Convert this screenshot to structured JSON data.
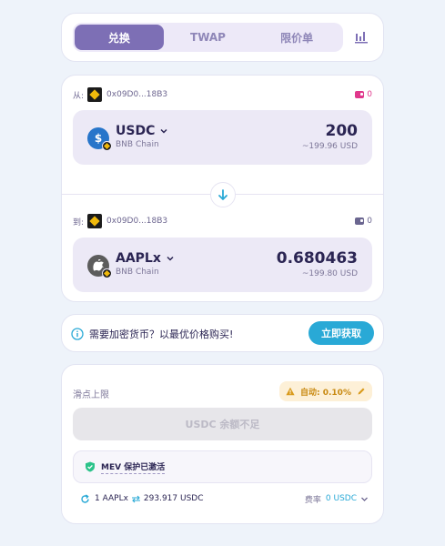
{
  "tabs": {
    "items": [
      {
        "label": "兑换",
        "active": true
      },
      {
        "label": "TWAP",
        "active": false
      },
      {
        "label": "限价单",
        "active": false
      }
    ],
    "chart_icon": "bar-chart-icon"
  },
  "swap": {
    "from": {
      "label": "从:",
      "address": "0x09D0...18B3",
      "balance": "0",
      "token": {
        "symbol": "USDC",
        "chain": "BNB Chain",
        "icon": "usdc-icon"
      },
      "amount": "200",
      "usd_value": "~199.96 USD"
    },
    "to": {
      "label": "到:",
      "address": "0x09D0...18B3",
      "balance": "0",
      "token": {
        "symbol": "AAPLx",
        "chain": "BNB Chain",
        "icon": "apple-icon"
      },
      "amount": "0.680463",
      "usd_value": "~199.80 USD"
    }
  },
  "banner": {
    "text": "需要加密货币？以最优价格购买!",
    "button": "立即获取"
  },
  "details": {
    "slippage_label": "滑点上限",
    "slippage_value": "自动: 0.10%",
    "action_button": "USDC 余额不足",
    "mev_text": "MEV 保护已激活",
    "rate": {
      "left": "1 AAPLx",
      "right": "293.917 USDC"
    },
    "fee_label": "费率",
    "fee_value": "0 USDC"
  },
  "colors": {
    "accent": "#7d6fb5",
    "cta": "#29a9d6",
    "warning": "#c98a12",
    "pink": "#e0388c",
    "bnb": "#f0b90b"
  }
}
